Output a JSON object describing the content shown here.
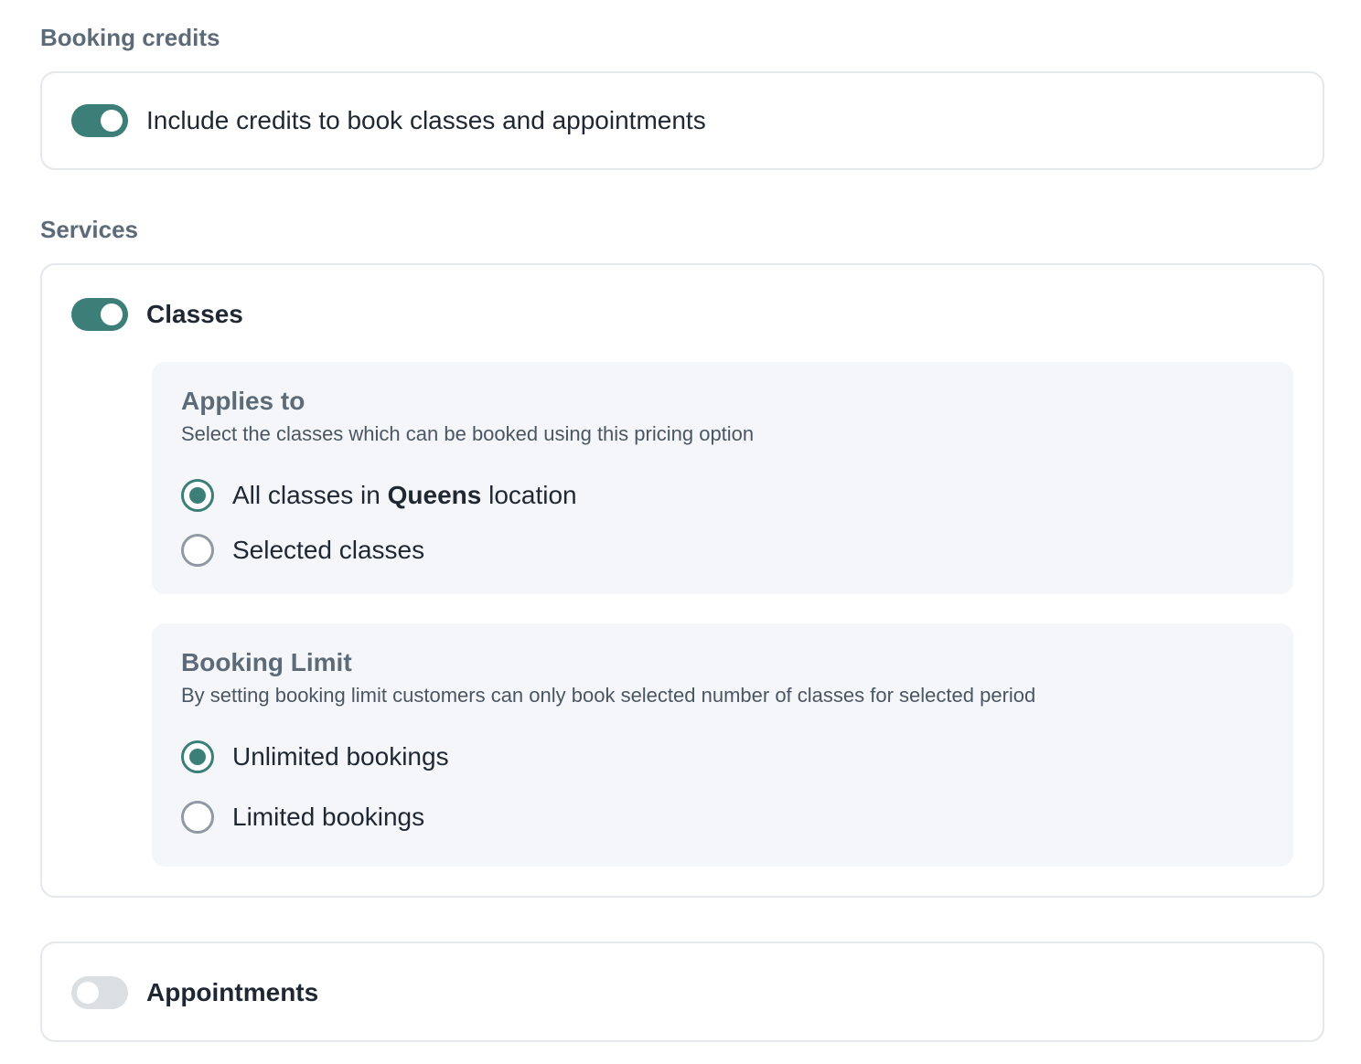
{
  "booking_credits": {
    "section_title": "Booking credits",
    "toggle_state": "on",
    "toggle_label": "Include credits to book classes and appointments"
  },
  "services": {
    "section_title": "Services",
    "classes": {
      "toggle_state": "on",
      "label": "Classes",
      "applies_to": {
        "title": "Applies to",
        "description": "Select the classes which can be booked using this pricing option",
        "options": [
          {
            "prefix": "All classes in ",
            "emphasis": "Queens",
            "suffix": " location",
            "checked": true
          },
          {
            "label": "Selected classes",
            "checked": false
          }
        ]
      },
      "booking_limit": {
        "title": "Booking Limit",
        "description": "By setting booking limit customers can only book selected number of classes for selected period",
        "options": [
          {
            "label": "Unlimited bookings",
            "checked": true
          },
          {
            "label": "Limited bookings",
            "checked": false
          }
        ]
      }
    },
    "appointments": {
      "toggle_state": "off",
      "label": "Appointments"
    }
  },
  "colors": {
    "accent": "#3b7f78",
    "toggle_off": "#dcdfe2",
    "panel_bg": "#f4f6f9",
    "section_title": "#5d6b78",
    "border": "#e4e7eb"
  }
}
